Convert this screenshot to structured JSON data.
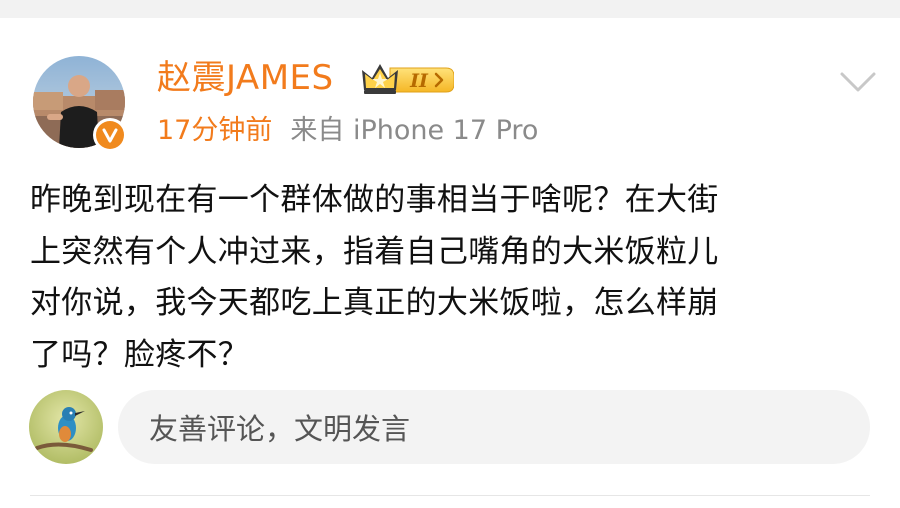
{
  "post": {
    "author": {
      "name": "赵震JAMES",
      "badge_level": "II",
      "verified": true
    },
    "time": "17分钟前",
    "source": "来自 iPhone 17 Pro",
    "content_lines": [
      "昨晚到现在有一个群体做的事相当于啥呢？在大街",
      "上突然有个人冲过来，指着自己嘴角的大米饭粒儿",
      "对你说，我今天都吃上真正的大米饭啦，怎么样崩",
      "了吗？脸疼不？"
    ]
  },
  "comment": {
    "placeholder": "友善评论，文明发言"
  },
  "icons": {
    "menu": "chevron-down-icon",
    "verified": "verified-badge-icon",
    "crown": "crown-badge-icon"
  },
  "colors": {
    "accent": "#f27b1c",
    "verified": "#f08a1e",
    "meta_gray": "#8a8a8a"
  }
}
